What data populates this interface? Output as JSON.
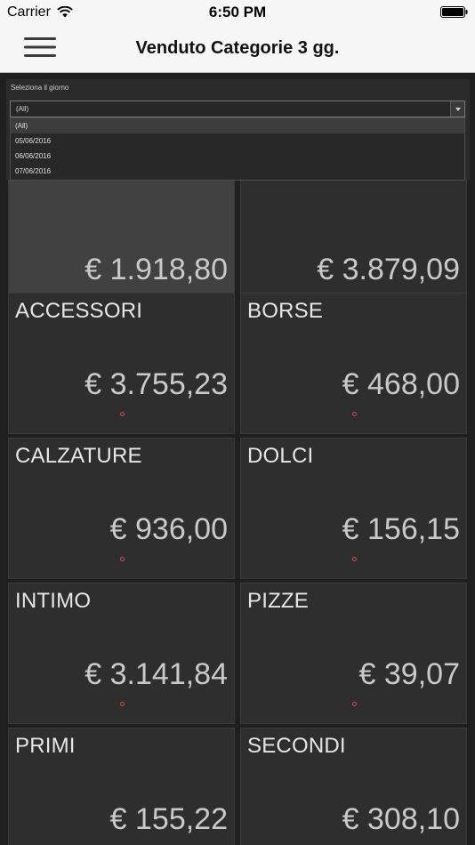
{
  "status_bar": {
    "carrier": "Carrier",
    "time": "6:50 PM"
  },
  "header": {
    "title": "Venduto Categorie 3 gg."
  },
  "filter": {
    "label": "Seleziona il giorno",
    "selected": "(All)",
    "options": [
      "(All)",
      "05/06/2016",
      "06/06/2016",
      "07/06/2016"
    ]
  },
  "tiles": [
    {
      "label": "",
      "value": "€ 1.918,80",
      "selected": true
    },
    {
      "label": "",
      "value": "€ 3.879,09"
    },
    {
      "label": "ACCESSORI",
      "value": "€ 3.755,23"
    },
    {
      "label": "BORSE",
      "value": "€ 468,00"
    },
    {
      "label": "CALZATURE",
      "value": "€ 936,00"
    },
    {
      "label": "DOLCI",
      "value": "€ 156,15"
    },
    {
      "label": "INTIMO",
      "value": "€ 3.141,84"
    },
    {
      "label": "PIZZE",
      "value": "€ 39,07"
    },
    {
      "label": "PRIMI",
      "value": "€ 155,22"
    },
    {
      "label": "SECONDI",
      "value": "€ 308,10"
    }
  ],
  "colors": {
    "tile_bg": "#2e2e2e",
    "tile_selected_bg": "#414141",
    "indicator_dot": "#d24a4a",
    "header_bg": "#f7f7f7"
  }
}
